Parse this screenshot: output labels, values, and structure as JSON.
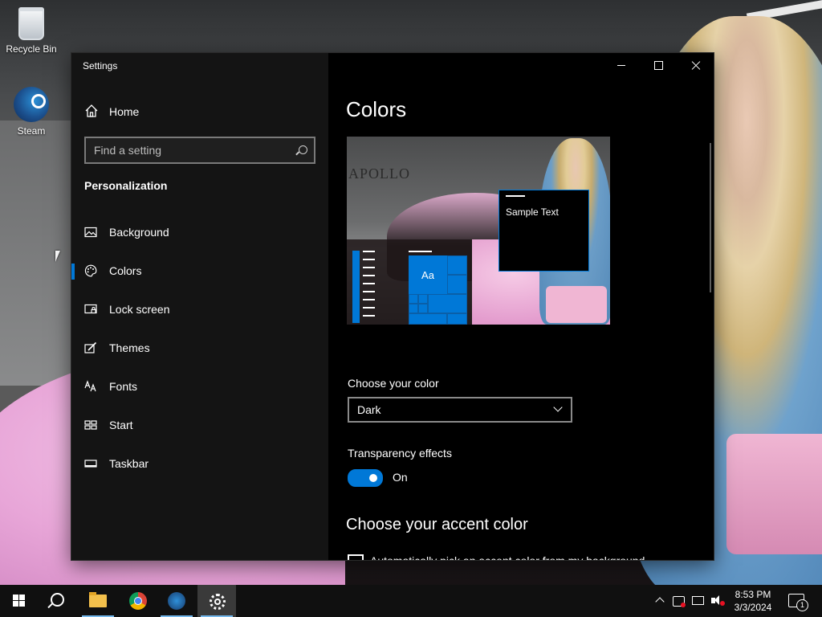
{
  "desktop": {
    "icons": [
      {
        "label": "Recycle Bin",
        "icon": "recycle-bin-icon"
      },
      {
        "label": "Steam",
        "icon": "steam-icon"
      }
    ]
  },
  "window": {
    "title": "Settings",
    "controls": {
      "minimize": "minimize-icon",
      "maximize": "maximize-icon",
      "close": "close-icon"
    }
  },
  "sidebar": {
    "home_label": "Home",
    "search_placeholder": "Find a setting",
    "section_heading": "Personalization",
    "selected_index": 1,
    "items": [
      {
        "label": "Background",
        "icon": "picture-icon"
      },
      {
        "label": "Colors",
        "icon": "palette-icon"
      },
      {
        "label": "Lock screen",
        "icon": "lock-screen-icon"
      },
      {
        "label": "Themes",
        "icon": "themes-brush-icon"
      },
      {
        "label": "Fonts",
        "icon": "font-icon"
      },
      {
        "label": "Start",
        "icon": "start-tiles-icon"
      },
      {
        "label": "Taskbar",
        "icon": "taskbar-icon"
      }
    ]
  },
  "main": {
    "title": "Colors",
    "preview": {
      "sample_text": "Sample Text",
      "tile_text": "Aa",
      "wallpaper_text": "APOLLO"
    },
    "choose_color": {
      "label": "Choose your color",
      "value": "Dark"
    },
    "transparency": {
      "label": "Transparency effects",
      "state": "On",
      "enabled": true
    },
    "accent": {
      "heading": "Choose your accent color",
      "auto_label": "Automatically pick an accent color from my background",
      "auto_checked": false
    }
  },
  "taskbar": {
    "apps": [
      {
        "name": "start-button",
        "icon": "windows-logo-icon"
      },
      {
        "name": "search-button",
        "icon": "search-icon"
      },
      {
        "name": "file-explorer",
        "icon": "folder-icon"
      },
      {
        "name": "chrome",
        "icon": "chrome-icon"
      },
      {
        "name": "steam",
        "icon": "steam-icon"
      },
      {
        "name": "settings",
        "icon": "gear-icon",
        "active": true
      }
    ],
    "time": "8:53 PM",
    "date": "3/3/2024",
    "notification_count": "1"
  },
  "colors": {
    "accent": "#0078d7",
    "window_bg": "#000000",
    "sidebar_bg": "#161616"
  }
}
